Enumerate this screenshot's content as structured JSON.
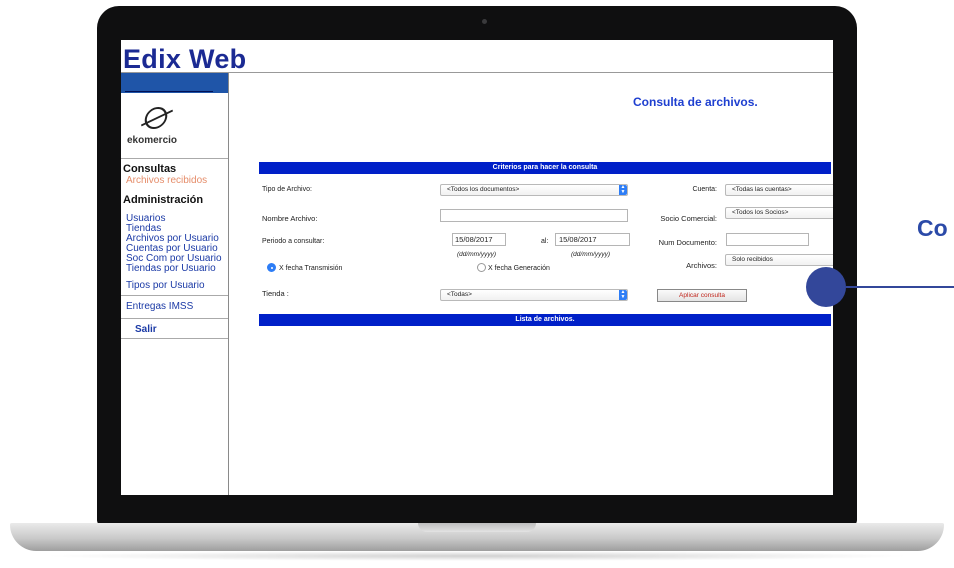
{
  "app": {
    "title": "Edix Web"
  },
  "logo": {
    "text": "ekomercio"
  },
  "sidebar": {
    "section_consultas": "Consultas",
    "archivos_recibidos": "Archivos recibidos",
    "section_admin": "Administración",
    "admin_items": [
      "Usuarios",
      "Tiendas",
      "Archivos por Usuario",
      "Cuentas por Usuario",
      "Soc Com por Usuario",
      "Tiendas por Usuario",
      "Tipos por Usuario"
    ],
    "entregas_imss": "Entregas IMSS",
    "salir": "Salir"
  },
  "main": {
    "heading": "Consulta de archivos.",
    "criteria_header": "Criterios para hacer la consulta",
    "results_header": "Lista de archivos."
  },
  "form": {
    "tipo_archivo_label": "Tipo de Archivo:",
    "tipo_archivo_value": "<Todos los documentos>",
    "cuenta_label": "Cuenta:",
    "cuenta_value": "<Todas las cuentas>",
    "nombre_archivo_label": "Nombre Archivo:",
    "nombre_archivo_value": "",
    "socio_comercial_label": "Socio Comercial:",
    "socio_comercial_value": "<Todos los Socios>",
    "periodo_label": "Periodo a consultar:",
    "fecha_desde": "15/08/2017",
    "al_label": "al:",
    "fecha_hasta": "15/08/2017",
    "date_hint": "(dd/mm/yyyy)",
    "num_documento_label": "Num Documento:",
    "num_documento_value": "",
    "archivos_label": "Archivos:",
    "archivos_value": "Solo recibidos",
    "radio_transmision": "X fecha Transmisión",
    "radio_generacion": "X fecha Generación",
    "radio_selected": "transmision",
    "tienda_label": "Tienda :",
    "tienda_value": "<Todas>",
    "apply_button": "Aplicar consulta"
  },
  "callout": {
    "text": "Co"
  },
  "colors": {
    "brand_blue": "#1b2a93",
    "band_blue": "#0020c8",
    "accent_blue": "#2d7df6",
    "link_active": "#e58d6a",
    "callout": "#33479a"
  }
}
